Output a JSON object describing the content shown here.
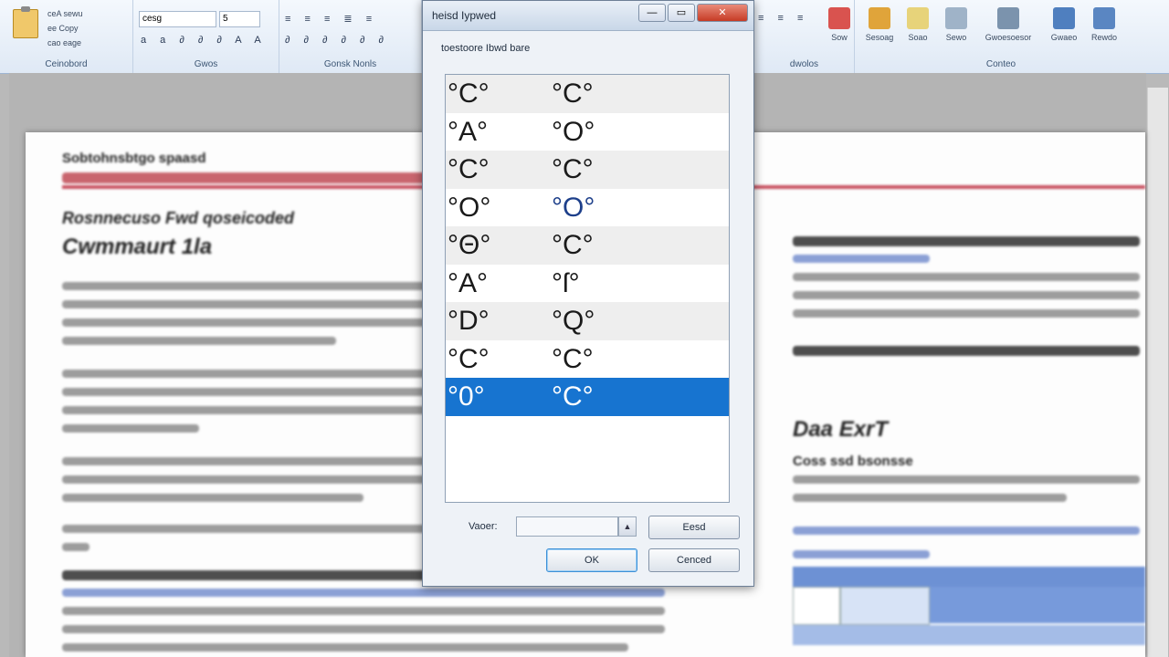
{
  "ribbon": {
    "groups": [
      {
        "id": "clipboard",
        "label": "Ceinobord"
      },
      {
        "id": "font",
        "label": "Gwos"
      },
      {
        "id": "paragraph",
        "label": "Gonsk Nonls"
      },
      {
        "id": "styles",
        "label": "dwolos"
      },
      {
        "id": "editing",
        "label": "Conteo"
      }
    ],
    "clipboard_items": [
      "ceA sewu",
      "ee Copy",
      "cao eage"
    ],
    "font_name": "cesg",
    "font_size": "5",
    "editing_buttons": [
      "Sow",
      "Sesoag",
      "Soao",
      "Sewo",
      "Gwoesoesor",
      "Gwaeo",
      "Rewdo"
    ]
  },
  "dialog": {
    "title": "heisd Iypwed",
    "list_label": "toestoore Ibwd bare",
    "rows": [
      {
        "c1": "°C°",
        "c2": "°C°"
      },
      {
        "c1": "°A°",
        "c2": "°O°"
      },
      {
        "c1": "°C°",
        "c2": "°C°"
      },
      {
        "c1": "°O°",
        "c2": "°O°"
      },
      {
        "c1": "°Θ°",
        "c2": "°C°"
      },
      {
        "c1": "°A°",
        "c2": "°ſ°"
      },
      {
        "c1": "°D°",
        "c2": "°Q°"
      },
      {
        "c1": "°C°",
        "c2": "°C°"
      },
      {
        "c1": "°0°",
        "c2": "°C°"
      }
    ],
    "selected_index": 8,
    "name_label": "Vaoer:",
    "name_value": "",
    "insert_label": "Eesd",
    "ok_label": "OK",
    "cancel_label": "Cenced",
    "close_glyph": "✕",
    "minimize_glyph": "—",
    "maximize_glyph": "▭"
  },
  "document": {
    "heading_small": "Sobtohnsbtgo spaasd",
    "heading_italic": "Rosnnecuso Fwd qoseicoded",
    "heading_large": "Cwmmaurt 1la",
    "right_heading": "Daa ExrT",
    "right_subheading": "Coss ssd bsonsse"
  },
  "colors": {
    "selection": "#1774d0",
    "close_button": "#c63b25",
    "rule": "#c85060"
  }
}
